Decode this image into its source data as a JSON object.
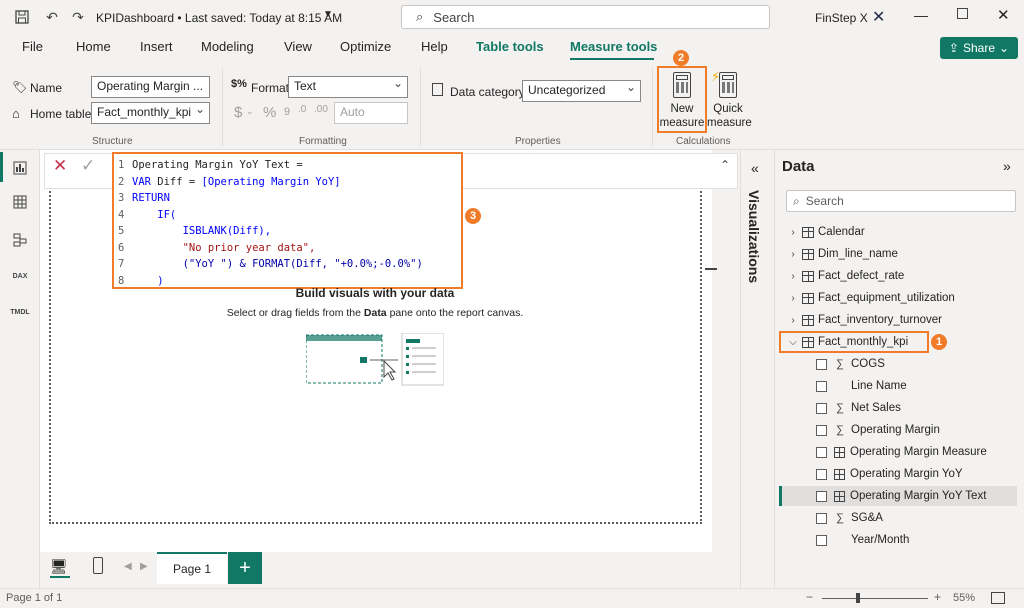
{
  "titlebar": {
    "doc_title": "KPIDashboard • Last saved: Today at 8:15 AM",
    "search_placeholder": "Search",
    "user": "FinStep X"
  },
  "menu": {
    "items": [
      "File",
      "Home",
      "Insert",
      "Modeling",
      "View",
      "Optimize",
      "Help",
      "Table tools",
      "Measure tools"
    ],
    "share": "Share"
  },
  "ribbon": {
    "name_label": "Name",
    "name_value": "Operating Margin ...",
    "home_table_label": "Home table",
    "home_table_value": "Fact_monthly_kpi",
    "structure_group": "Structure",
    "format_label": "Format",
    "format_value": "Text",
    "auto_value": "Auto",
    "formatting_group": "Formatting",
    "data_category_label": "Data category",
    "data_category_value": "Uncategorized",
    "properties_group": "Properties",
    "new_measure": "New measure",
    "new_measure_l1": "New",
    "new_measure_l2": "measure",
    "quick_measure_l1": "Quick",
    "quick_measure_l2": "measure",
    "calculations_group": "Calculations"
  },
  "dax": {
    "lines": [
      {
        "n": "1",
        "text": "Operating Margin YoY Text ="
      },
      {
        "n": "2",
        "text": "VAR Diff = [Operating Margin YoY]"
      },
      {
        "n": "3",
        "text": "RETURN"
      },
      {
        "n": "4",
        "text": "    IF("
      },
      {
        "n": "5",
        "text": "        ISBLANK(Diff),"
      },
      {
        "n": "6",
        "text": "        \"No prior year data\","
      },
      {
        "n": "7",
        "text": "        (\"YoY \") & FORMAT(Diff, \"+0.0%;-0.0%\")"
      },
      {
        "n": "8",
        "text": "    )"
      }
    ]
  },
  "canvas": {
    "title": "Build visuals with your data",
    "subtitle_pre": "Select or drag fields from the ",
    "subtitle_bold": "Data",
    "subtitle_post": " pane onto the report canvas."
  },
  "pages": {
    "tab": "Page 1",
    "add": "+"
  },
  "status": {
    "page_info": "Page 1 of 1",
    "zoom": "55%"
  },
  "viz_pane": {
    "label": "Visualizations"
  },
  "data_pane": {
    "title": "Data",
    "search_placeholder": "Search",
    "tables": [
      {
        "name": "Calendar",
        "expanded": false
      },
      {
        "name": "Dim_line_name",
        "expanded": false
      },
      {
        "name": "Fact_defect_rate",
        "expanded": false
      },
      {
        "name": "Fact_equipment_utilization",
        "expanded": false
      },
      {
        "name": "Fact_inventory_turnover",
        "expanded": false
      },
      {
        "name": "Fact_monthly_kpi",
        "expanded": true
      }
    ],
    "fields": [
      {
        "name": "COGS",
        "icon": "sigma"
      },
      {
        "name": "Line Name",
        "icon": "none"
      },
      {
        "name": "Net Sales",
        "icon": "sigma"
      },
      {
        "name": "Operating Margin",
        "icon": "sigma"
      },
      {
        "name": "Operating Margin Measure",
        "icon": "calculator"
      },
      {
        "name": "Operating Margin YoY",
        "icon": "calculator"
      },
      {
        "name": "Operating Margin YoY Text",
        "icon": "calculator"
      },
      {
        "name": "SG&A",
        "icon": "sigma"
      },
      {
        "name": "Year/Month",
        "icon": "none"
      }
    ]
  },
  "annotations": {
    "badge1": "1",
    "badge2": "2",
    "badge3": "3"
  },
  "colors": {
    "accent": "#117865",
    "highlight": "#f07c29"
  }
}
